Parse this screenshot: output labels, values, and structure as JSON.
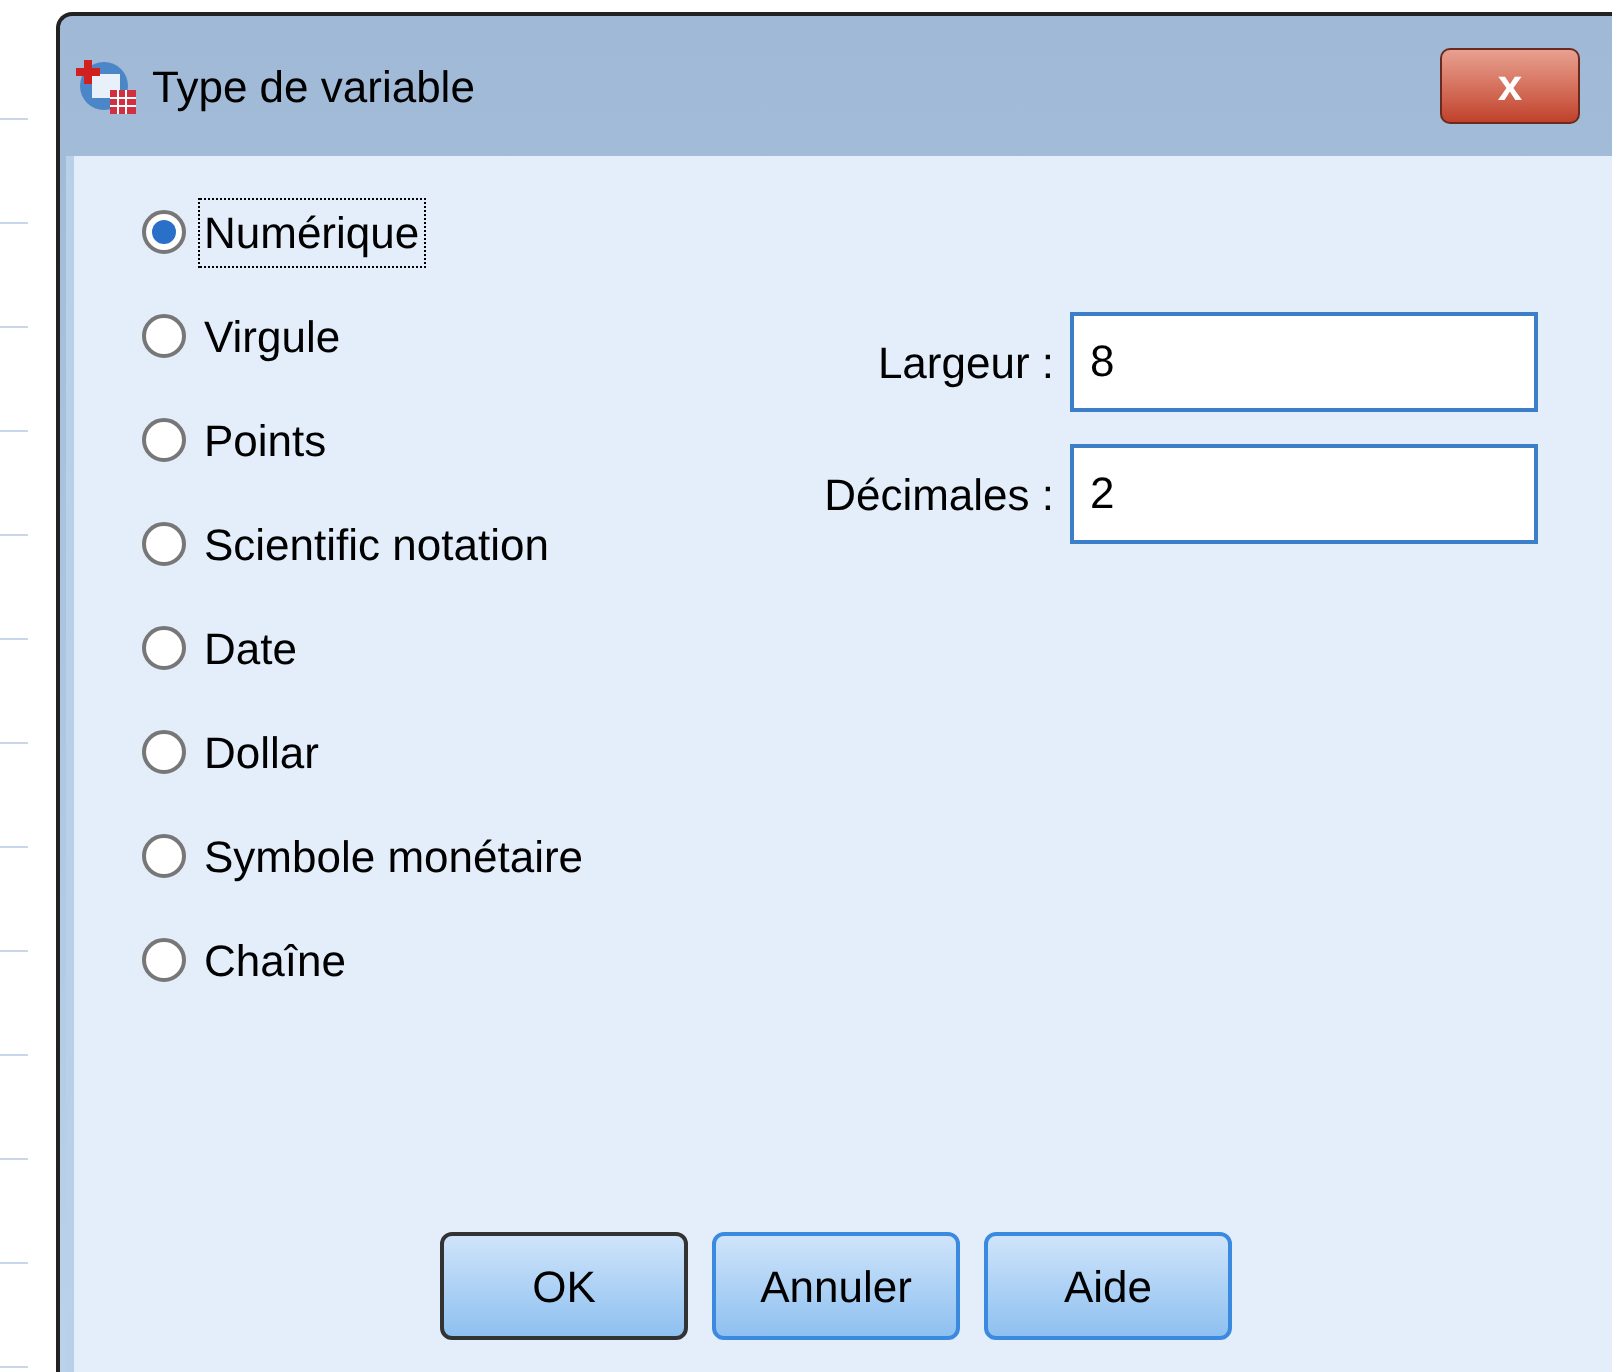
{
  "window": {
    "title": "Type de variable",
    "close_label": "x"
  },
  "types": [
    {
      "label": "Numérique",
      "selected": true,
      "focused": true
    },
    {
      "label": "Virgule",
      "selected": false,
      "focused": false
    },
    {
      "label": "Points",
      "selected": false,
      "focused": false
    },
    {
      "label": "Scientific notation",
      "selected": false,
      "focused": false
    },
    {
      "label": "Date",
      "selected": false,
      "focused": false
    },
    {
      "label": "Dollar",
      "selected": false,
      "focused": false
    },
    {
      "label": "Symbole monétaire",
      "selected": false,
      "focused": false
    },
    {
      "label": "Chaîne",
      "selected": false,
      "focused": false
    }
  ],
  "fields": [
    {
      "label": "Largeur :",
      "value": "8"
    },
    {
      "label": "Décimales :",
      "value": "2"
    }
  ],
  "buttons": [
    {
      "label": "OK",
      "default": true
    },
    {
      "label": "Annuler",
      "default": false
    },
    {
      "label": "Aide",
      "default": false
    }
  ]
}
